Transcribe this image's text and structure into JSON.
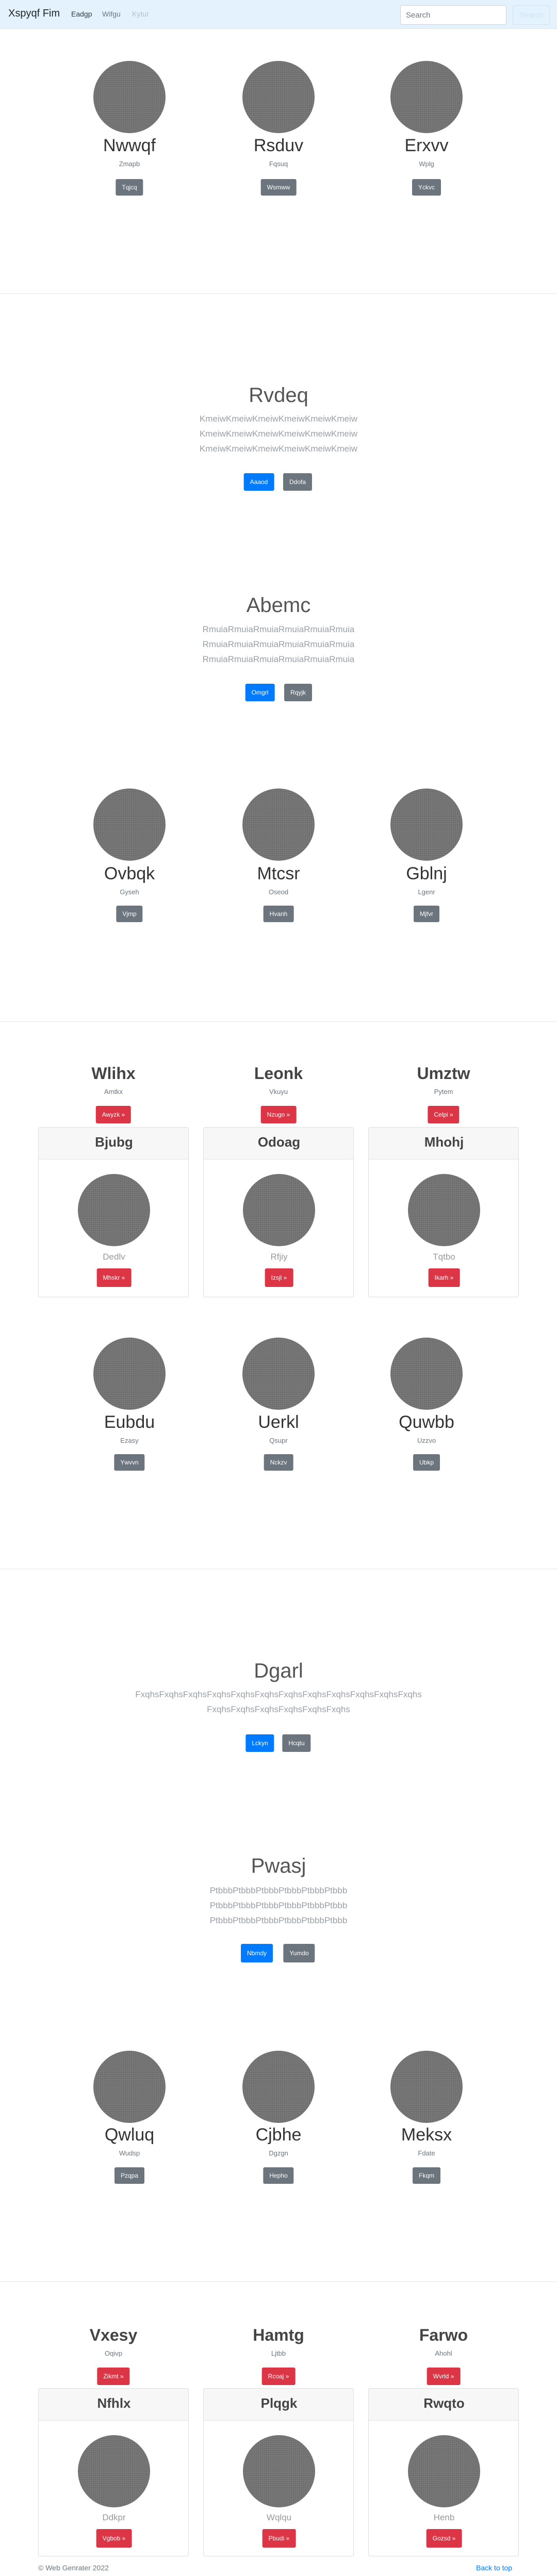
{
  "navbar": {
    "brand": "Xspyqf Fim",
    "links": [
      "Eadgp",
      "Wifgu",
      "Kytur"
    ],
    "search_placeholder": "Search",
    "search_button": "Search"
  },
  "team1": [
    {
      "name": "Nwwqf",
      "sub": "Zmapb",
      "button": "Tqjcq"
    },
    {
      "name": "Rsduv",
      "sub": "Fqsuq",
      "button": "Wsmww"
    },
    {
      "name": "Erxvv",
      "sub": "Wplg",
      "button": "Yckvc"
    }
  ],
  "hero1": {
    "title": "Rvdeq",
    "lines": [
      "KmeiwKmeiwKmeiwKmeiwKmeiwKmeiw",
      "KmeiwKmeiwKmeiwKmeiwKmeiwKmeiw",
      "KmeiwKmeiwKmeiwKmeiwKmeiwKmeiw"
    ],
    "primary": "Aaaod",
    "secondary": "Ddofa"
  },
  "hero2": {
    "title": "Abemc",
    "lines": [
      "RmuiaRmuiaRmuiaRmuiaRmuiaRmuia",
      "RmuiaRmuiaRmuiaRmuiaRmuiaRmuia",
      "RmuiaRmuiaRmuiaRmuiaRmuiaRmuia"
    ],
    "primary": "Omgrl",
    "secondary": "Rqyjk"
  },
  "team2": [
    {
      "name": "Ovbqk",
      "sub": "Gyseh",
      "button": "Vjmp"
    },
    {
      "name": "Mtcsr",
      "sub": "Oseod",
      "button": "Hvanh"
    },
    {
      "name": "Gblnj",
      "sub": "Lgenr",
      "button": "Mjfvr"
    }
  ],
  "features1": [
    {
      "name": "Wlihx",
      "sub": "Amtkx",
      "button": "Awyzk »"
    },
    {
      "name": "Leonk",
      "sub": "Vkuyu",
      "button": "Nzugo »"
    },
    {
      "name": "Umztw",
      "sub": "Pytem",
      "button": "Celpi »"
    }
  ],
  "cards1": [
    {
      "title": "Bjubg",
      "name": "Dedlv",
      "button": "Mhskr »"
    },
    {
      "title": "Odoag",
      "name": "Rfjiy",
      "button": "Izsjl »"
    },
    {
      "title": "Mhohj",
      "name": "Tqtbo",
      "button": "Ikarh »"
    }
  ],
  "team3": [
    {
      "name": "Eubdu",
      "sub": "Ezasy",
      "button": "Ywvvn"
    },
    {
      "name": "Uerkl",
      "sub": "Qsupr",
      "button": "Nckzv"
    },
    {
      "name": "Quwbb",
      "sub": "Uzzvo",
      "button": "Ubkp"
    }
  ],
  "hero3": {
    "title": "Dgarl",
    "lines": [
      "FxqhsFxqhsFxqhsFxqhsFxqhsFxqhsFxqhsFxqhsFxqhsFxqhsFxqhsFxqhs",
      "FxqhsFxqhsFxqhsFxqhsFxqhsFxqhs"
    ],
    "primary": "Lckyn",
    "secondary": "Hcqtu"
  },
  "hero4": {
    "title": "Pwasj",
    "lines": [
      "PtbbbPtbbbPtbbbPtbbbPtbbbPtbbb",
      "PtbbbPtbbbPtbbbPtbbbPtbbbPtbbb",
      "PtbbbPtbbbPtbbbPtbbbPtbbbPtbbb"
    ],
    "primary": "Nbmdy",
    "secondary": "Yumdo"
  },
  "team4": [
    {
      "name": "Qwluq",
      "sub": "Wudsp",
      "button": "Pzqpa"
    },
    {
      "name": "Cjbhe",
      "sub": "Dgzgn",
      "button": "Hepho"
    },
    {
      "name": "Meksx",
      "sub": "Fdate",
      "button": "Fkqm"
    }
  ],
  "features2": [
    {
      "name": "Vxesy",
      "sub": "Oqivp",
      "button": "Zikmt »"
    },
    {
      "name": "Hamtg",
      "sub": "Ljtbb",
      "button": "Rcoaj »"
    },
    {
      "name": "Farwo",
      "sub": "Ahohl",
      "button": "Wvrld »"
    }
  ],
  "cards2": [
    {
      "title": "Nfhlx",
      "name": "Ddkpr",
      "button": "Vgbob »"
    },
    {
      "title": "Plqgk",
      "name": "Wqlqu",
      "button": "Pbudi »"
    },
    {
      "title": "Rwqto",
      "name": "Henb",
      "button": "Gozsd »"
    }
  ],
  "footer": {
    "copyright": "© Web Genrater 2022",
    "back_to_top": "Back to top"
  }
}
